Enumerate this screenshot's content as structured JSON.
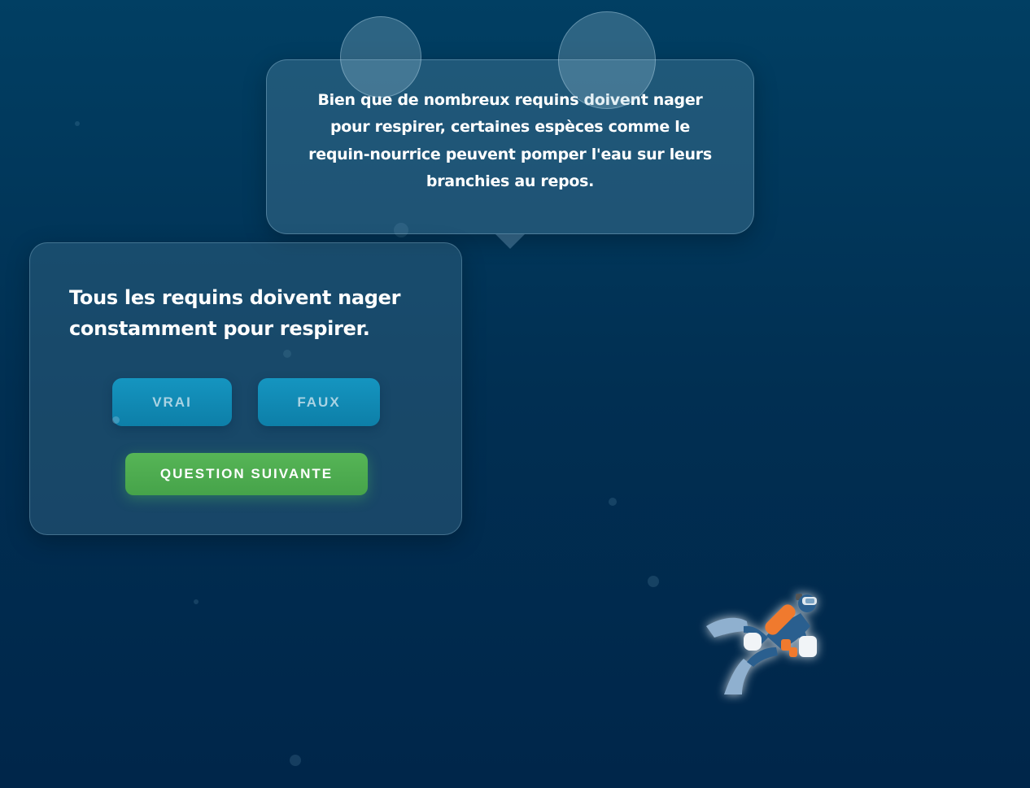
{
  "fact_bubble": {
    "text": "Bien que de nombreux requins doivent nager pour respirer, certaines espèces comme le requin-nourrice peuvent pomper l'eau sur leurs branchies au repos."
  },
  "quiz": {
    "question": "Tous les requins doivent nager constamment pour respirer.",
    "true_label": "VRAI",
    "false_label": "FAUX",
    "next_label": "QUESTION SUIVANTE"
  },
  "colors": {
    "ocean_top": "#013f63",
    "ocean_bottom": "#00264a",
    "answer_button": "#1390bb",
    "next_button": "#4fad50",
    "diver_tank": "#f07a2e",
    "diver_suit": "#2a5f8f"
  },
  "icons": {
    "diver": "scuba-diver-icon",
    "bubbles": "bubble-icon"
  }
}
